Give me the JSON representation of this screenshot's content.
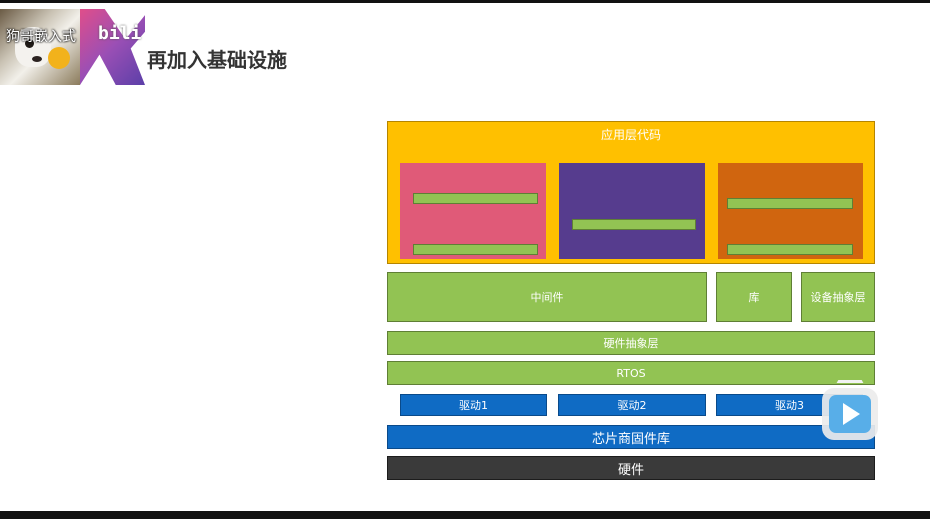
{
  "header": {
    "logo_text": "狗哥嵌入式",
    "logo_watermark": "bili",
    "title": "再加入基础设施"
  },
  "diagram": {
    "app_layer": "应用层代码",
    "middleware": "中间件",
    "library": "库",
    "device_abstraction": "设备抽象层",
    "hal": "硬件抽象层",
    "rtos": "RTOS",
    "drivers": [
      "驱动1",
      "驱动2",
      "驱动3"
    ],
    "vendor_firmware": "芯片商固件库",
    "hardware": "硬件"
  },
  "colors": {
    "app_layer": "#ffc000",
    "app_box_1": "#e05a78",
    "app_box_2": "#563c8e",
    "app_box_3": "#d0650f",
    "green": "#92c353",
    "blue": "#0f6bc4",
    "dark": "#3a3a3a"
  },
  "icons": {
    "play": "bilibili-play-icon"
  }
}
